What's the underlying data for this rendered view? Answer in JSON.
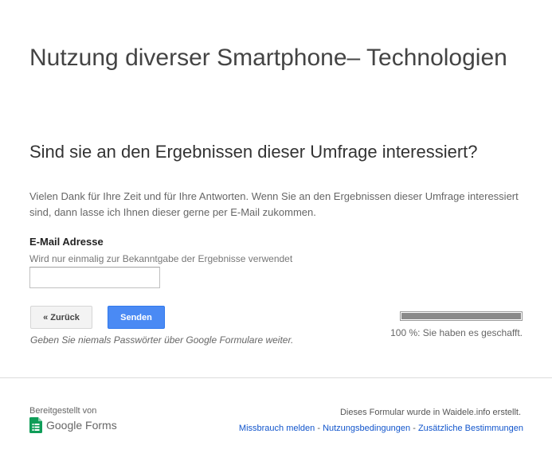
{
  "form": {
    "title": "Nutzung diverser Smartphone– Technologien"
  },
  "section": {
    "title": "Sind sie an den Ergebnissen dieser Umfrage interessiert?",
    "description": "Vielen Dank für Ihre Zeit und für Ihre Antworten. Wenn Sie an den Ergebnissen dieser Umfrage interessiert sind, dann lasse ich Ihnen dieser gerne per E-Mail zukommen."
  },
  "question": {
    "label": "E-Mail Adresse",
    "help": "Wird nur einmalig zur Bekanntgabe der Ergebnisse verwendet",
    "value": ""
  },
  "buttons": {
    "back": "« Zurück",
    "send": "Senden"
  },
  "progress": {
    "percent": 100,
    "text": "100 %: Sie haben es geschafft."
  },
  "warning": "Geben Sie niemals Passwörter über Google Formulare weiter.",
  "footer": {
    "powered_by": "Bereitgestellt von",
    "logo_google": "Google",
    "logo_forms": "Forms",
    "created_by": "Dieses Formular wurde in Waidele.info erstellt.",
    "links": {
      "abuse": "Missbrauch melden",
      "terms": "Nutzungsbedingungen",
      "additional": "Zusätzliche Bestimmungen",
      "separator": " - "
    }
  },
  "colors": {
    "send_button": "#4a8af4",
    "link": "#1155cc",
    "progress_fill": "#8a8a8a",
    "forms_icon": "#0f9d58"
  }
}
